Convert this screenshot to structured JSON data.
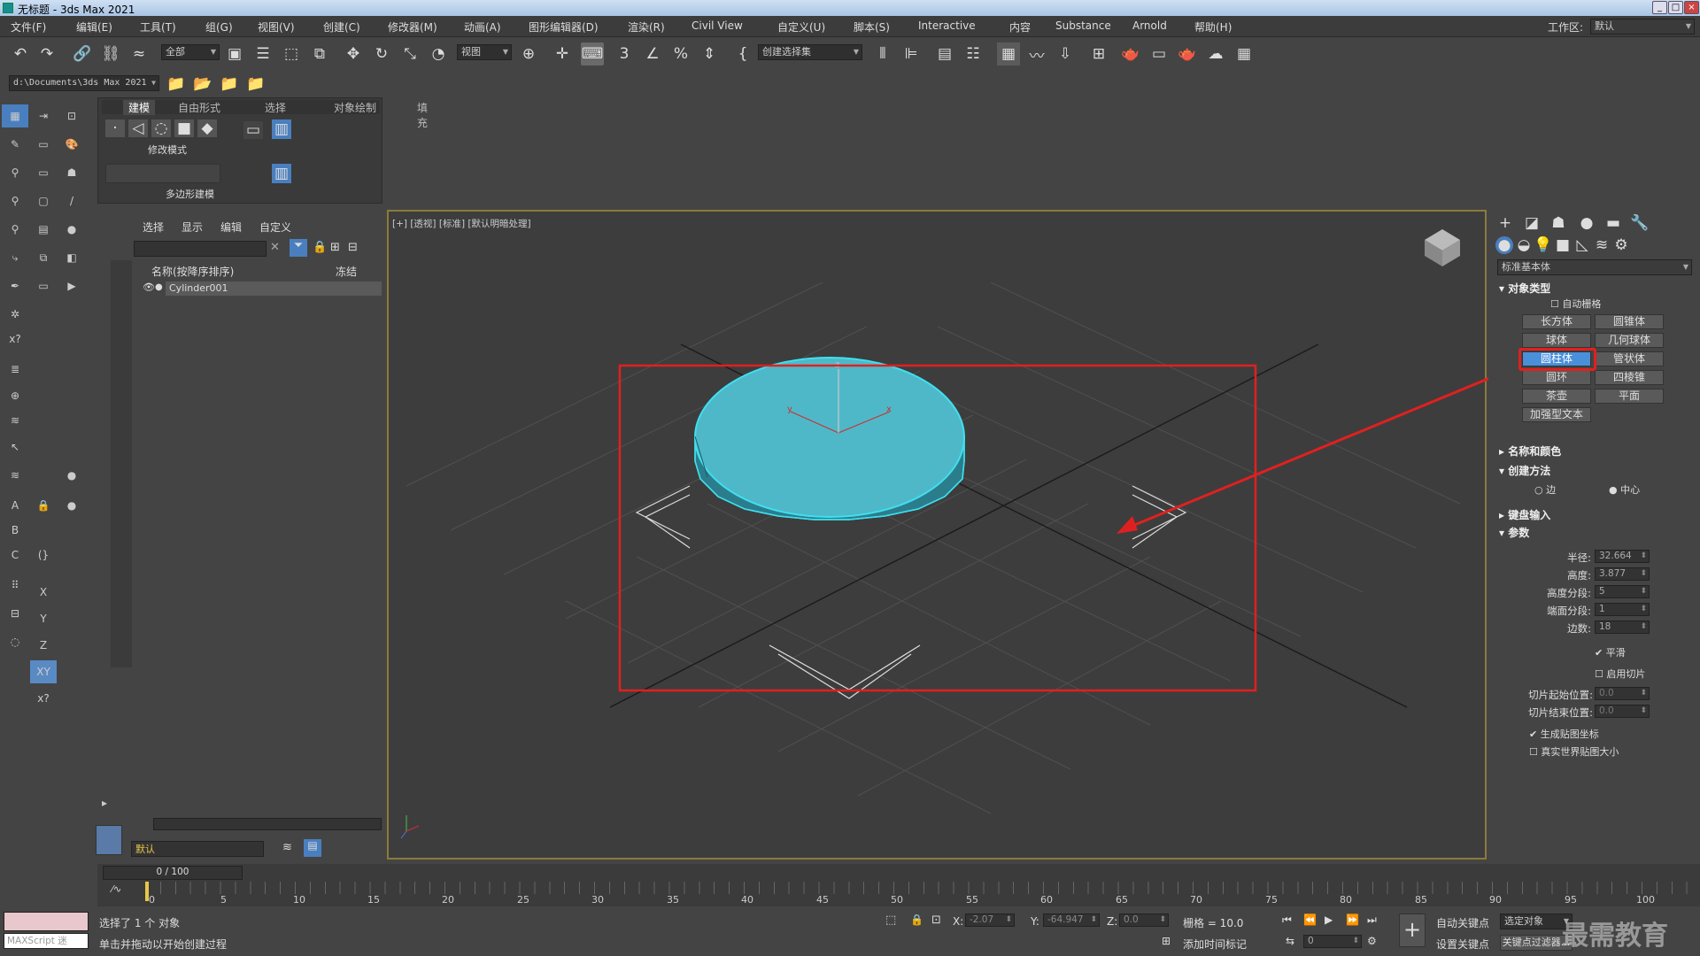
{
  "titlebar": {
    "title": "无标题 - 3ds Max 2021",
    "btn_min": "_",
    "btn_max": "□",
    "btn_close": "×"
  },
  "menubar": {
    "items": [
      "文件(F)",
      "编辑(E)",
      "工具(T)",
      "组(G)",
      "视图(V)",
      "创建(C)",
      "修改器(M)",
      "动画(A)",
      "图形编辑器(D)",
      "渲染(R)",
      "Civil View",
      "自定义(U)",
      "脚本(S)",
      "Interactive",
      "内容",
      "Substance",
      "Arnold",
      "帮助(H)"
    ],
    "workspace_label": "工作区:",
    "workspace_value": "默认"
  },
  "toolbar": {
    "filter_all": "全部",
    "ref_coord": "视图",
    "selection_set": "创建选择集",
    "snap_3": "3"
  },
  "toolbar2": {
    "path": "d:\\Documents\\3ds Max 2021"
  },
  "ribbon": {
    "tabs": [
      "建模",
      "自由形式",
      "选择",
      "对象绘制",
      "填充"
    ],
    "mode_label": "修改模式",
    "footer": "多边形建模"
  },
  "scene": {
    "tabs": [
      "选择",
      "显示",
      "编辑",
      "自定义"
    ],
    "column_name": "名称(按降序排序)",
    "column_freeze": "冻结",
    "object": "Cylinder001",
    "layer": "默认"
  },
  "viewport": {
    "label": "[+] [透视] [标准] [默认明暗处理]",
    "axis_x": "x",
    "axis_y": "y",
    "axis_z": "z",
    "object_color": "#4fb8c8"
  },
  "cmdpanel": {
    "category": "标准基本体",
    "section_object_type": "对象类型",
    "autogrid": "自动栅格",
    "buttons": [
      "长方体",
      "圆锥体",
      "球体",
      "几何球体",
      "圆柱体",
      "管状体",
      "圆环",
      "四棱锥",
      "茶壶",
      "平面",
      "加强型文本"
    ],
    "active_button": "圆柱体",
    "section_name_color": "名称和颜色",
    "section_creation": "创建方法",
    "opt_edge": "边",
    "opt_center": "中心",
    "section_keyboard": "键盘输入",
    "section_params": "参数",
    "params": [
      {
        "label": "半径:",
        "value": "32.664"
      },
      {
        "label": "高度:",
        "value": "3.877"
      },
      {
        "label": "高度分段:",
        "value": "5"
      },
      {
        "label": "端面分段:",
        "value": "1"
      },
      {
        "label": "边数:",
        "value": "18"
      }
    ],
    "smooth": "平滑",
    "slice_on": "启用切片",
    "slice_from": "切片起始位置:",
    "slice_from_val": "0.0",
    "slice_to": "切片结束位置:",
    "slice_to_val": "0.0",
    "gen_map": "生成贴图坐标",
    "real_world": "真实世界贴图大小"
  },
  "timeline": {
    "frame": "0 / 100",
    "ticks": [
      "0",
      "5",
      "10",
      "15",
      "20",
      "25",
      "30",
      "35",
      "40",
      "45",
      "50",
      "55",
      "60",
      "65",
      "70",
      "75",
      "80",
      "85",
      "90",
      "95",
      "100"
    ]
  },
  "status": {
    "maxscript": "MAXScript 迷",
    "selected": "选择了 1 个 对象",
    "prompt": "单击并拖动以开始创建过程",
    "x_label": "X:",
    "x_val": "-2.07",
    "y_label": "Y:",
    "y_val": "-64.947",
    "z_label": "Z:",
    "z_val": "0.0",
    "grid": "栅格 = 10.0",
    "add_time_tag": "添加时间标记",
    "auto_key": "自动关键点",
    "set_key": "设置关键点",
    "selected_obj": "选定对象",
    "key_filters": "关键点过滤器...",
    "frame_input": "0",
    "watermark": "最需教育"
  },
  "annotation_color": "#e02020"
}
